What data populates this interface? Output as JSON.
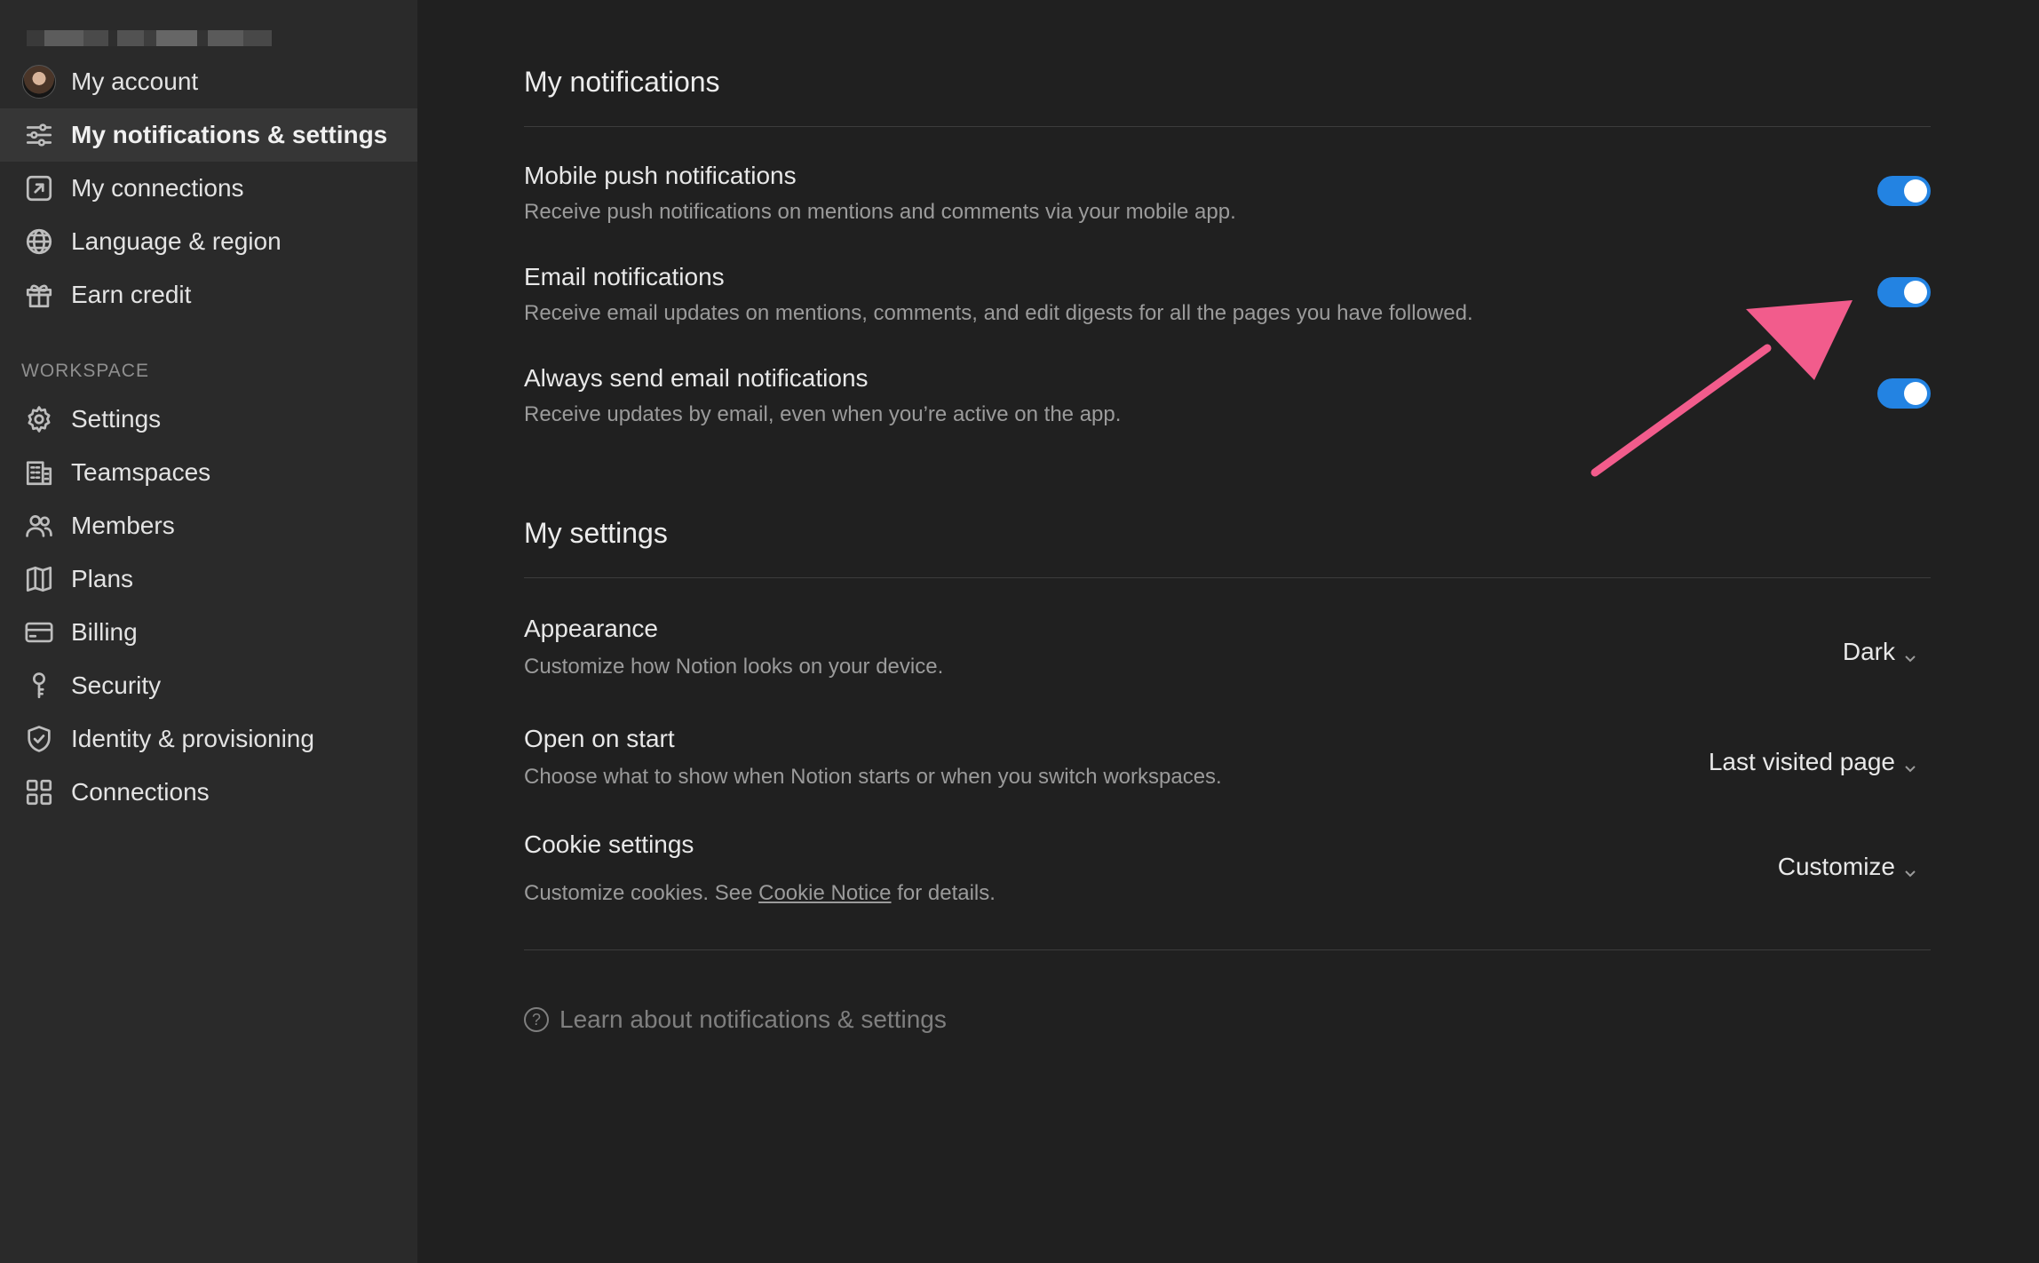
{
  "sidebar": {
    "account_items": [
      {
        "label": "My account",
        "icon": "avatar"
      },
      {
        "label": "My notifications & settings",
        "icon": "sliders-icon",
        "active": true
      },
      {
        "label": "My connections",
        "icon": "external-link-icon"
      },
      {
        "label": "Language & region",
        "icon": "globe-icon"
      },
      {
        "label": "Earn credit",
        "icon": "gift-icon"
      }
    ],
    "workspace_label": "WORKSPACE",
    "workspace_items": [
      {
        "label": "Settings",
        "icon": "gear-icon"
      },
      {
        "label": "Teamspaces",
        "icon": "building-icon"
      },
      {
        "label": "Members",
        "icon": "people-icon"
      },
      {
        "label": "Plans",
        "icon": "map-icon"
      },
      {
        "label": "Billing",
        "icon": "credit-card-icon"
      },
      {
        "label": "Security",
        "icon": "key-icon"
      },
      {
        "label": "Identity & provisioning",
        "icon": "shield-check-icon"
      },
      {
        "label": "Connections",
        "icon": "grid-icon"
      }
    ]
  },
  "notifications": {
    "title": "My notifications",
    "items": [
      {
        "title": "Mobile push notifications",
        "description": "Receive push notifications on mentions and comments via your mobile app.",
        "enabled": true
      },
      {
        "title": "Email notifications",
        "description": "Receive email updates on mentions, comments, and edit digests for all the pages you have followed.",
        "enabled": true
      },
      {
        "title": "Always send email notifications",
        "description": "Receive updates by email, even when you’re active on the app.",
        "enabled": true
      }
    ]
  },
  "settings": {
    "title": "My settings",
    "appearance": {
      "title": "Appearance",
      "description": "Customize how Notion looks on your device.",
      "value": "Dark"
    },
    "open_on_start": {
      "title": "Open on start",
      "description": "Choose what to show when Notion starts or when you switch workspaces.",
      "value": "Last visited page"
    },
    "cookie": {
      "title": "Cookie settings",
      "description_prefix": "Customize cookies. See ",
      "link": "Cookie Notice",
      "description_suffix": " for details.",
      "value": "Customize"
    }
  },
  "footer": {
    "learn_label": "Learn about notifications & settings"
  },
  "colors": {
    "accent": "#2383e2",
    "annotation_arrow": "#f25c8c"
  }
}
